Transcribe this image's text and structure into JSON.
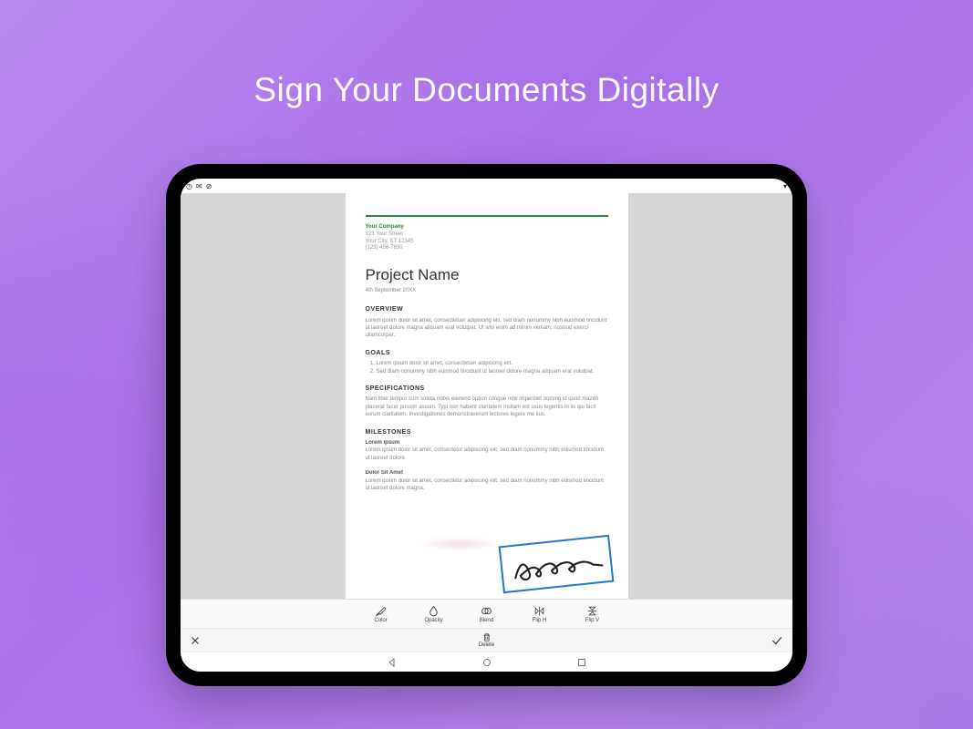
{
  "headline": "Sign Your Documents Digitally",
  "document": {
    "company": {
      "name": "Your Company",
      "street": "123 Your Street",
      "city_line": "Your City, ST 12345",
      "phone": "(123) 456-7890"
    },
    "title": "Project Name",
    "date": "4th September 20XX",
    "sections": {
      "overview": {
        "heading": "OVERVIEW",
        "body": "Lorem ipsum dolor sit amet, consectetuer adipiscing elit, sed diam nonummy nibh euismod tincidunt ut laoreet dolore magna aliquam erat volutpat. Ut wisi enim ad minim veniam, nostrud exerci ullamcorper."
      },
      "goals": {
        "heading": "GOALS",
        "item1": "Lorem ipsum dolor sit amet, consectetuer adipiscing elit.",
        "item2": "Sed diam nonummy nibh euismod tincidunt ut laoreet dolore magna aliquam erat volutpat."
      },
      "specifications": {
        "heading": "SPECIFICATIONS",
        "body": "Nam liber tempor cum soluta nobis eleifend option congue nihil imperdiet doming id quod mazim placerat facer possim assum. Typi non habent claritatem insitam est usus legentis in iis qui facit eorum claritatem. Investigationes demonstraverunt lectores legere me lius."
      },
      "milestones": {
        "heading": "MILESTONES",
        "sub1_label": "Lorem Ipsum",
        "sub1_body": "Lorem ipsum dolor sit amet, consectetur adipiscing elit, sed diam nonummy nibh euismod tincidunt ut laoreet dolore.",
        "sub2_label": "Dolor Sit Amet",
        "sub2_body": "Lorem ipsum dolor sit amet, consectetur adipiscing elit, sed diam nonummy nibh euismod tincidunt ut laoreet dolore magna."
      }
    }
  },
  "toolbar": {
    "color": "Color",
    "opacity": "Opacity",
    "blend": "Blend",
    "flip_h": "Flip H",
    "flip_v": "Flip V"
  },
  "actionbar": {
    "delete": "Delete"
  }
}
